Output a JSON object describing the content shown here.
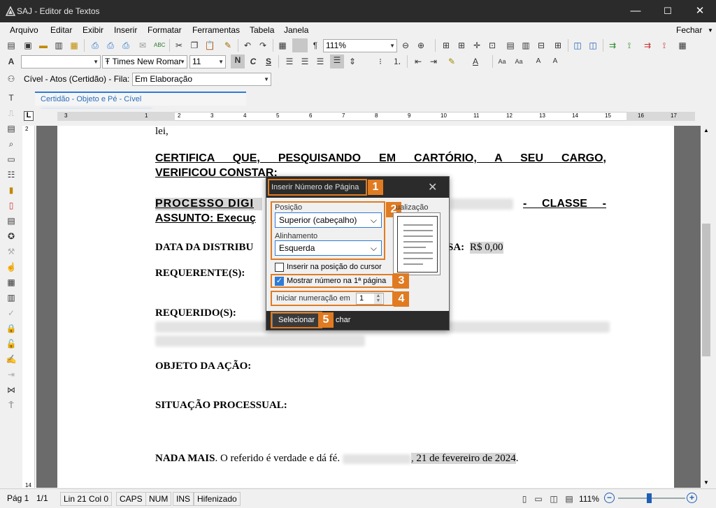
{
  "window": {
    "title": "SAJ - Editor de Textos",
    "minimize": "—",
    "maximize": "☐",
    "close": "✕"
  },
  "menu": {
    "items": [
      "Arquivo",
      "Editar",
      "Exibir",
      "Inserir",
      "Formatar",
      "Ferramentas",
      "Tabela",
      "Janela"
    ],
    "right": "Fechar"
  },
  "toolbar": {
    "zoom": "111%",
    "font_family": "Times New Romar",
    "font_size": "11"
  },
  "document_bar": {
    "label": "Cível - Atos (Certidão) - Fila:",
    "queue_value": "Em Elaboração"
  },
  "tab": {
    "label": "Certidão - Objeto e Pé - Cível"
  },
  "ruler": {
    "numbers": [
      "3",
      "1",
      "2",
      "3",
      "4",
      "5",
      "6",
      "7",
      "8",
      "9",
      "10",
      "11",
      "12",
      "13",
      "14",
      "15",
      "16",
      "17"
    ]
  },
  "document": {
    "line_lei": "lei,",
    "cert_line1": "CERTIFICA QUE, PESQUISANDO EM CARTÓRIO, A SEU CARGO,",
    "cert_line2": "VERIFICOU CONSTAR:",
    "processo_left": "PROCESSO DIGI",
    "processo_right": "- CLASSE -",
    "assunto": "ASSUNTO: Execuç",
    "data_dist": "DATA DA DISTRIBU",
    "valor_label": "SA:",
    "valor_value": "R$ 0,00",
    "requerente": "REQUERENTE(S):",
    "requerido": "REQUERIDO(S):",
    "objeto": "OBJETO DA AÇÃO:",
    "situacao": "SITUAÇÃO PROCESSUAL:",
    "nada_mais_bold": "NADA MAIS",
    "nada_mais_text": ". O referido é verdade e dá fé.",
    "date_text": ", 21 de fevereiro de 2024",
    "date_end": "."
  },
  "dialog": {
    "title": "Inserir Número de Página",
    "posicao_label": "Posição",
    "posicao_value": "Superior (cabeçalho)",
    "alinhamento_label": "Alinhamento",
    "alinhamento_value": "Esquerda",
    "preview_label": "ualização",
    "checkbox_cursor": "Inserir na posição do cursor",
    "checkbox_first_page": "Mostrar número na 1ª página",
    "start_label": "Iniciar numeração em",
    "start_value": "1",
    "select_button": "Selecionar",
    "close_button": "char",
    "badges": [
      "1",
      "2",
      "3",
      "4",
      "5"
    ],
    "accent_color": "#e07b22"
  },
  "status": {
    "page": "Pág 1",
    "pages": "1/1",
    "position": "Lin 21  Col 0",
    "caps": "CAPS",
    "num": "NUM",
    "ins": "INS",
    "hyphen": "Hifenizado",
    "zoom": "111%"
  }
}
